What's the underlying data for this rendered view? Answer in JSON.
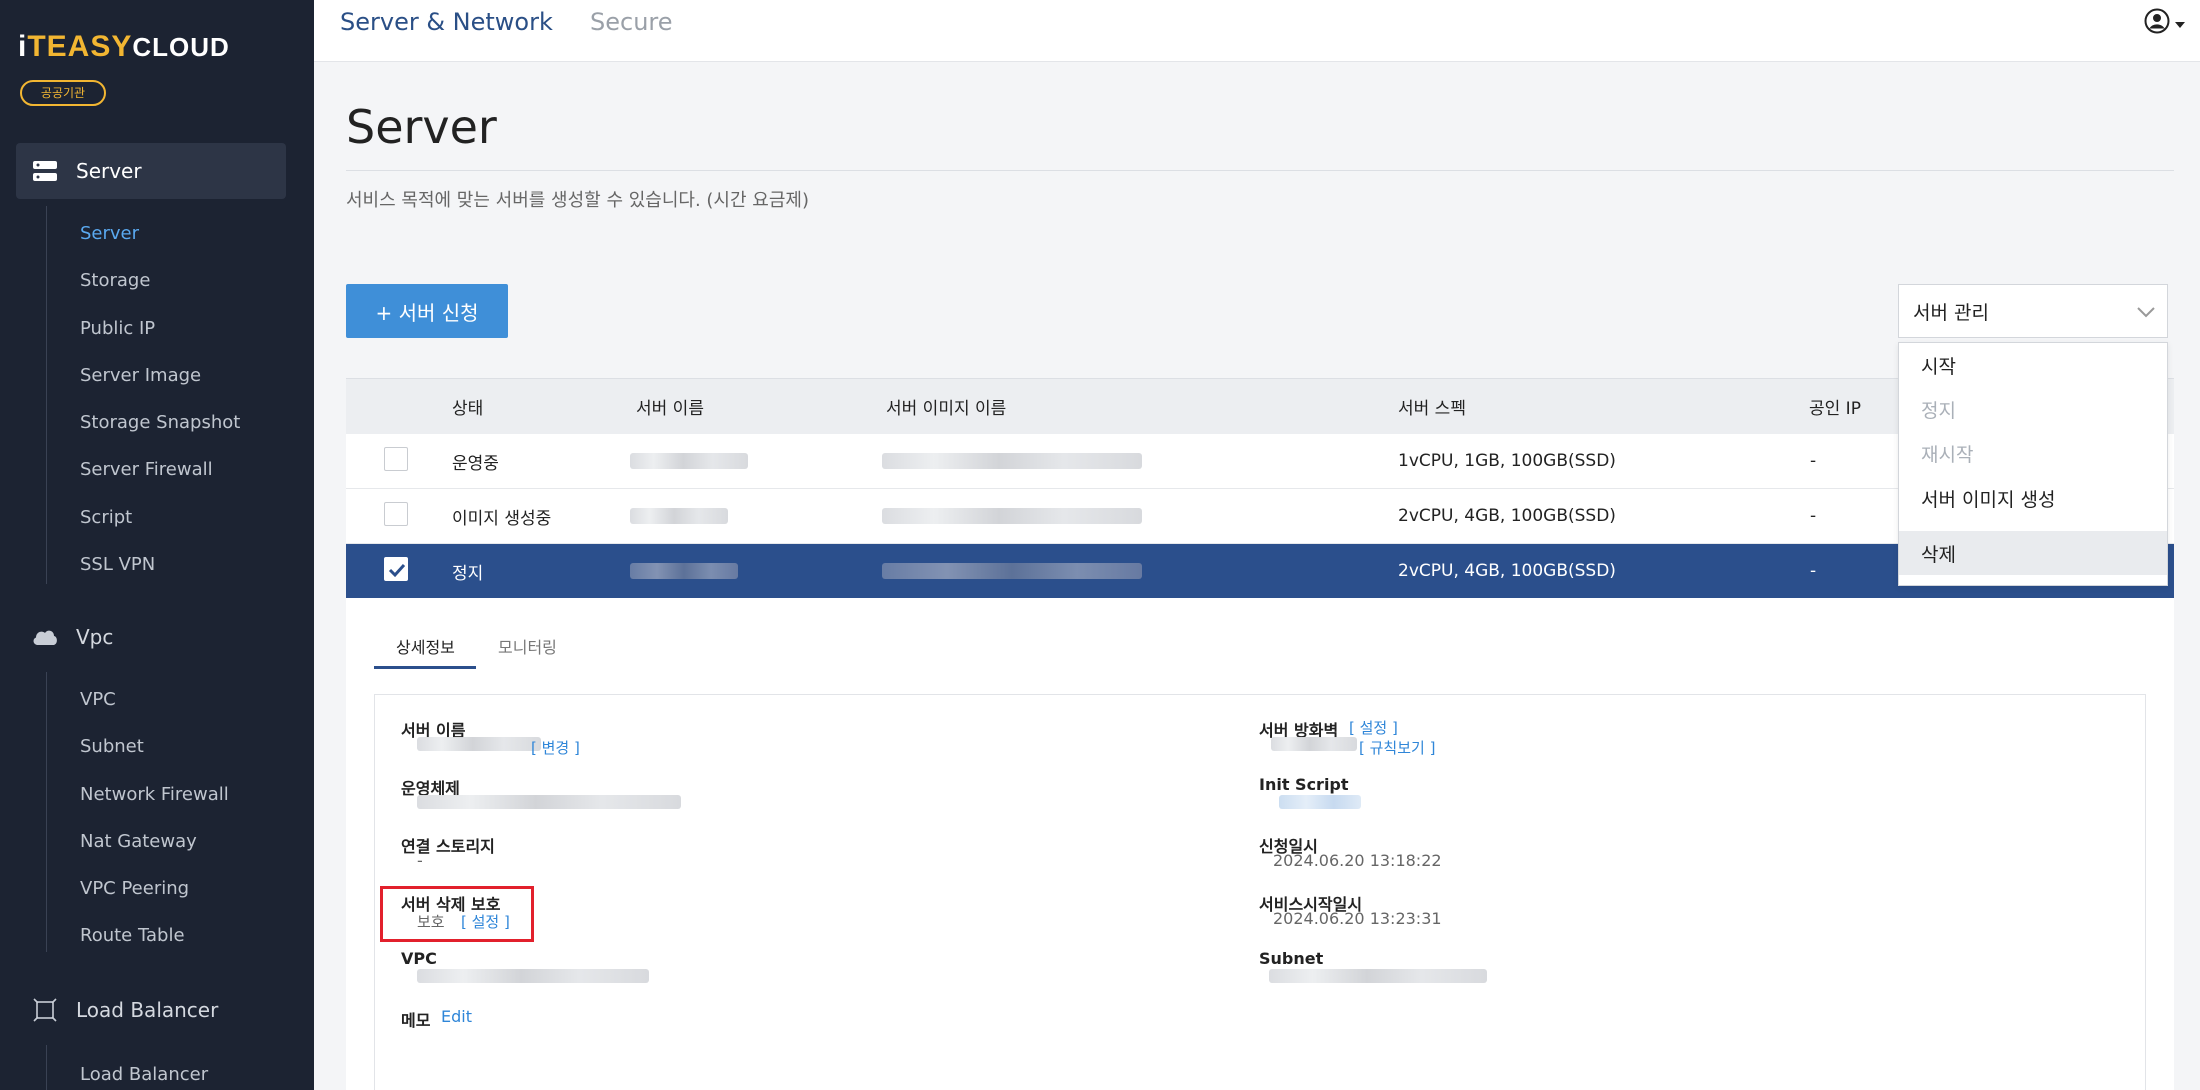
{
  "brand": {
    "logo_i": "i",
    "logo_t": "T",
    "logo_easy": "EASY",
    "logo_cloud": "CLOUD",
    "badge": "공공기관",
    "accent_color": "#f2b632"
  },
  "sidebar": {
    "groups": [
      {
        "label": "Server",
        "icon": "server-icon",
        "active": true
      },
      {
        "label": "Vpc",
        "icon": "cloud-icon",
        "active": false
      },
      {
        "label": "Load Balancer",
        "icon": "load-balancer-icon",
        "active": false
      }
    ],
    "server_items": [
      "Server",
      "Storage",
      "Public IP",
      "Server Image",
      "Storage Snapshot",
      "Server Firewall",
      "Script",
      "SSL VPN"
    ],
    "vpc_items": [
      "VPC",
      "Subnet",
      "Network Firewall",
      "Nat Gateway",
      "VPC Peering",
      "Route Table"
    ],
    "lb_items": [
      "Load Balancer"
    ],
    "active_item": "Server"
  },
  "header": {
    "tabs": [
      "Server & Network",
      "Secure"
    ],
    "active_tab": "Server & Network",
    "user_icon": "user-circle-icon"
  },
  "page": {
    "title": "Server",
    "description": "서비스 목적에 맞는 서버를 생성할 수 있습니다. (시간 요금제)",
    "create_button": "+ 서버 신청",
    "manage_select": "서버 관리"
  },
  "table": {
    "headers": [
      "상태",
      "서버 이름",
      "서버 이미지 이름",
      "서버 스펙",
      "공인 IP"
    ],
    "rows": [
      {
        "status": "운영중",
        "spec": "1vCPU, 1GB, 100GB(SSD)",
        "public_ip": "-",
        "checked": false
      },
      {
        "status": "이미지 생성중",
        "spec": "2vCPU, 4GB, 100GB(SSD)",
        "public_ip": "-",
        "checked": false
      },
      {
        "status": "정지",
        "spec": "2vCPU, 4GB, 100GB(SSD)",
        "public_ip": "-",
        "checked": true
      }
    ]
  },
  "dropdown": {
    "items": [
      {
        "label": "시작",
        "disabled": false
      },
      {
        "label": "정지",
        "disabled": true
      },
      {
        "label": "재시작",
        "disabled": true
      },
      {
        "label": "서버 이미지 생성",
        "disabled": false
      },
      {
        "label": "삭제",
        "disabled": false,
        "hovered": true
      }
    ]
  },
  "detail": {
    "tabs": [
      "상세정보",
      "모니터링"
    ],
    "active_tab": "상세정보",
    "left": {
      "server_name_label": "서버 이름",
      "server_name_link": "[ 변경 ]",
      "os_label": "운영체제",
      "storage_label": "연결 스토리지",
      "storage_value": "-",
      "delete_protect_label": "서버 삭제 보호",
      "delete_protect_value": "보호",
      "delete_protect_link": "[ 설정 ]",
      "vpc_label": "VPC",
      "memo_label": "메모",
      "memo_link": "Edit"
    },
    "right": {
      "firewall_label": "서버 방화벽",
      "firewall_link": "[ 설정 ]",
      "firewall_rules_link": "[ 규칙보기 ]",
      "init_label": "Init Script",
      "requested_label": "신청일시",
      "requested_value": "2024.06.20 13:18:22",
      "started_label": "서비스시작일시",
      "started_value": "2024.06.20 13:23:31",
      "subnet_label": "Subnet"
    }
  }
}
